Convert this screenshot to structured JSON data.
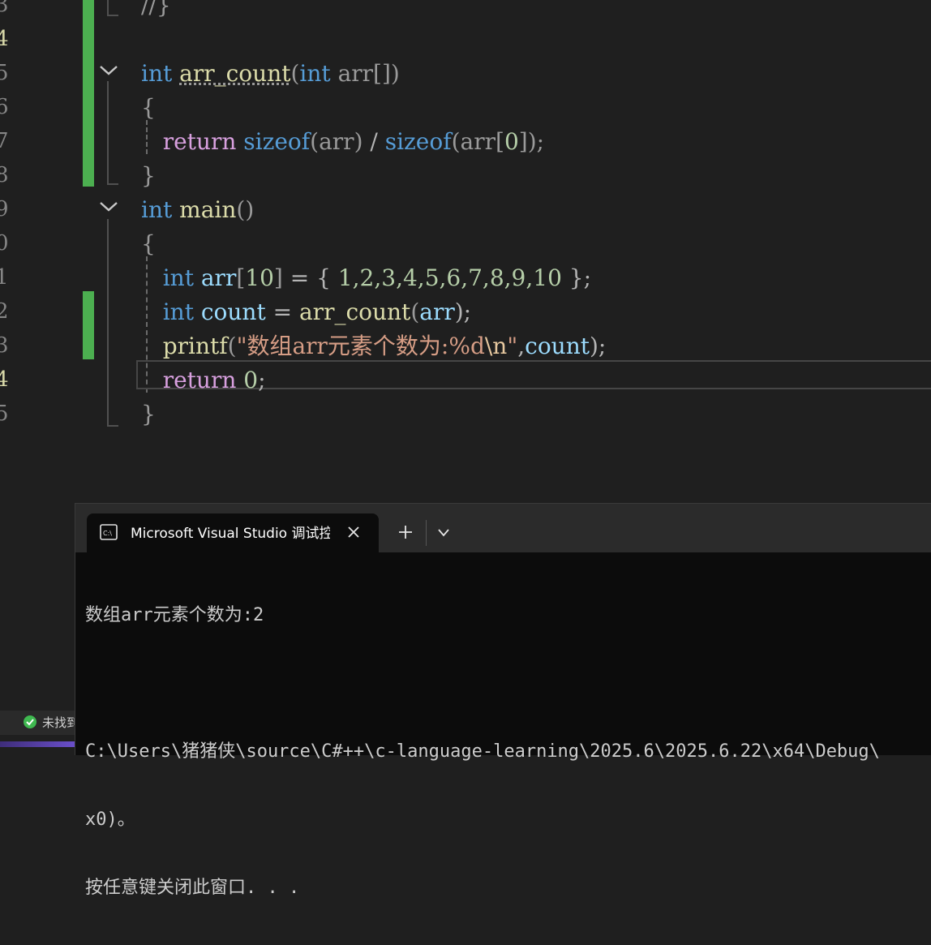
{
  "editor": {
    "line_numbers": [
      {
        "text": "3",
        "active": false
      },
      {
        "text": "4",
        "active": true
      },
      {
        "text": "5",
        "active": false
      },
      {
        "text": "6",
        "active": false
      },
      {
        "text": "7",
        "active": false
      },
      {
        "text": "8",
        "active": false
      },
      {
        "text": "9",
        "active": false
      },
      {
        "text": "0",
        "active": false
      },
      {
        "text": "1",
        "active": false
      },
      {
        "text": "2",
        "active": false
      },
      {
        "text": "3",
        "active": false
      },
      {
        "text": "4",
        "active": true
      },
      {
        "text": "5",
        "active": false
      }
    ],
    "lines": [
      {
        "tokens": [
          {
            "t": "//}",
            "c": "par"
          }
        ]
      },
      {
        "tokens": []
      },
      {
        "tokens": [
          {
            "t": "int",
            "c": "kw"
          },
          {
            "t": " "
          },
          {
            "t": "arr_count",
            "c": "fn sq"
          },
          {
            "t": "(",
            "c": "par"
          },
          {
            "t": "int",
            "c": "kw"
          },
          {
            "t": " "
          },
          {
            "t": "arr",
            "c": "par"
          },
          {
            "t": "[])",
            "c": "par"
          }
        ]
      },
      {
        "tokens": [
          {
            "t": "{",
            "c": "par"
          }
        ]
      },
      {
        "tokens": [
          {
            "t": "   "
          },
          {
            "t": "return",
            "c": "ctl"
          },
          {
            "t": " "
          },
          {
            "t": "sizeof",
            "c": "kw"
          },
          {
            "t": "(",
            "c": "par"
          },
          {
            "t": "arr",
            "c": "par"
          },
          {
            "t": ")",
            "c": "par"
          },
          {
            "t": " / ",
            "c": "pun"
          },
          {
            "t": "sizeof",
            "c": "kw"
          },
          {
            "t": "(",
            "c": "par"
          },
          {
            "t": "arr",
            "c": "par"
          },
          {
            "t": "[",
            "c": "par"
          },
          {
            "t": "0",
            "c": "num"
          },
          {
            "t": "]);",
            "c": "par"
          }
        ]
      },
      {
        "tokens": [
          {
            "t": "}",
            "c": "par"
          }
        ]
      },
      {
        "tokens": [
          {
            "t": "int",
            "c": "kw"
          },
          {
            "t": " "
          },
          {
            "t": "main",
            "c": "fn"
          },
          {
            "t": "()",
            "c": "par"
          }
        ]
      },
      {
        "tokens": [
          {
            "t": "{",
            "c": "par"
          }
        ]
      },
      {
        "tokens": [
          {
            "t": "   "
          },
          {
            "t": "int",
            "c": "kw"
          },
          {
            "t": " "
          },
          {
            "t": "arr",
            "c": "var"
          },
          {
            "t": "[",
            "c": "par"
          },
          {
            "t": "10",
            "c": "num"
          },
          {
            "t": "]",
            "c": "par"
          },
          {
            "t": " = { ",
            "c": "pun"
          },
          {
            "t": "1,2,3,4,5,6,7,8,9,10",
            "c": "num"
          },
          {
            "t": " };",
            "c": "pun"
          }
        ]
      },
      {
        "tokens": [
          {
            "t": "   "
          },
          {
            "t": "int",
            "c": "kw"
          },
          {
            "t": " "
          },
          {
            "t": "count",
            "c": "var"
          },
          {
            "t": " = ",
            "c": "pun"
          },
          {
            "t": "arr_count",
            "c": "fn"
          },
          {
            "t": "(",
            "c": "par"
          },
          {
            "t": "arr",
            "c": "var"
          },
          {
            "t": ");",
            "c": "pun"
          }
        ]
      },
      {
        "tokens": [
          {
            "t": "   "
          },
          {
            "t": "printf",
            "c": "fn"
          },
          {
            "t": "(",
            "c": "par"
          },
          {
            "t": "\"数组arr元素个数为:%d",
            "c": "str"
          },
          {
            "t": "\\n",
            "c": "esc"
          },
          {
            "t": "\"",
            "c": "str"
          },
          {
            "t": ",",
            "c": "pun"
          },
          {
            "t": "count",
            "c": "var"
          },
          {
            "t": ");",
            "c": "pun"
          }
        ]
      },
      {
        "tokens": [
          {
            "t": "   "
          },
          {
            "t": "return",
            "c": "ctl"
          },
          {
            "t": " "
          },
          {
            "t": "0",
            "c": "num"
          },
          {
            "t": ";",
            "c": "pun"
          }
        ]
      },
      {
        "tokens": [
          {
            "t": "}",
            "c": "par"
          }
        ]
      }
    ]
  },
  "terminal": {
    "tab_title": "Microsoft Visual Studio 调试控制台",
    "new_tab_symbol": "+",
    "output_lines": [
      "数组arr元素个数为:2",
      "",
      "C:\\Users\\猪猪侠\\source\\C#++\\c-language-learning\\2025.6\\2025.6.22\\x64\\Debug\\",
      "x0)。",
      "按任意键关闭此窗口. . ."
    ]
  },
  "status_bar": {
    "text": "未找到"
  },
  "colors": {
    "editor_bg": "#1f1f1f",
    "git_added": "#4caf50",
    "terminal_bg": "#0c0c0c",
    "keyword": "#569cd6",
    "control": "#d8a0df",
    "function": "#dcdcaa",
    "variable": "#9cdcfe",
    "number": "#b5cea8",
    "string": "#d69d85"
  }
}
